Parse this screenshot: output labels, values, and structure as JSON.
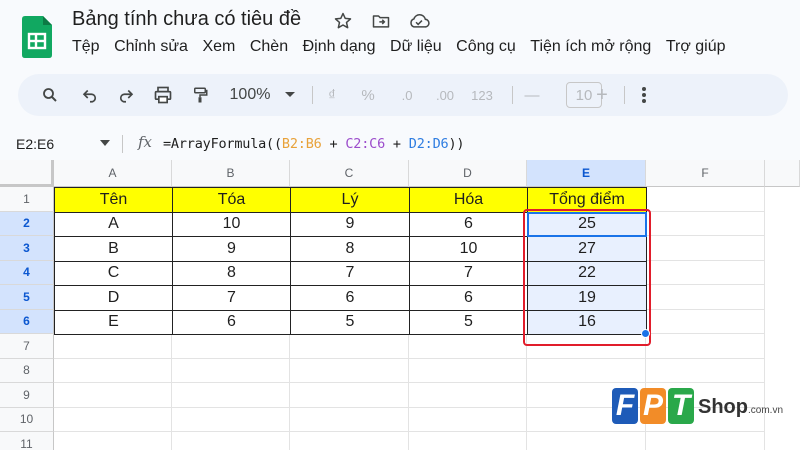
{
  "app": {
    "title": "Bảng tính chưa có tiêu đề",
    "icons": [
      "star-icon",
      "move-to-folder-icon",
      "cloud-status-icon"
    ]
  },
  "menu": [
    "Tệp",
    "Chỉnh sửa",
    "Xem",
    "Chèn",
    "Định dạng",
    "Dữ liệu",
    "Công cụ",
    "Tiện ích mở rộng",
    "Trợ giúp"
  ],
  "toolbar": {
    "zoom": "100%",
    "currency": "₫",
    "percent": "%",
    "decrease_decimal": ".0",
    "increase_decimal": ".00",
    "more_formats": "123",
    "font_size": "10",
    "minus": "—",
    "plus": "+"
  },
  "formula_bar": {
    "name_box": "E2:E6",
    "fx": "fx",
    "formula_prefix": "=ArrayFormula((",
    "ref1": "B2:B6",
    "op1": " + ",
    "ref2": "C2:C6",
    "op2": " + ",
    "ref3": "D2:D6",
    "formula_suffix": "))"
  },
  "sheet": {
    "columns": [
      "A",
      "B",
      "C",
      "D",
      "E",
      "F"
    ],
    "selected_column": "E",
    "row_numbers": [
      "1",
      "2",
      "3",
      "4",
      "5",
      "6",
      "7",
      "8",
      "9",
      "10",
      "11"
    ],
    "selected_rows": [
      "2",
      "3",
      "4",
      "5",
      "6"
    ],
    "header": [
      "Tên",
      "Tóa",
      "Lý",
      "Hóa",
      "Tổng điểm"
    ],
    "rows": [
      [
        "A",
        "10",
        "9",
        "6",
        "25"
      ],
      [
        "B",
        "9",
        "8",
        "10",
        "27"
      ],
      [
        "C",
        "8",
        "7",
        "7",
        "22"
      ],
      [
        "D",
        "7",
        "6",
        "6",
        "19"
      ],
      [
        "E",
        "6",
        "5",
        "5",
        "16"
      ]
    ],
    "header_fill": "#ffff00",
    "highlight_box_color": "#e11d2b"
  },
  "watermark": {
    "letters": [
      "F",
      "P",
      "T"
    ],
    "letter_colors": [
      "#1e5bb8",
      "#f28c28",
      "#2aa84a"
    ],
    "shop": "Shop",
    "domain": ".com.vn"
  }
}
